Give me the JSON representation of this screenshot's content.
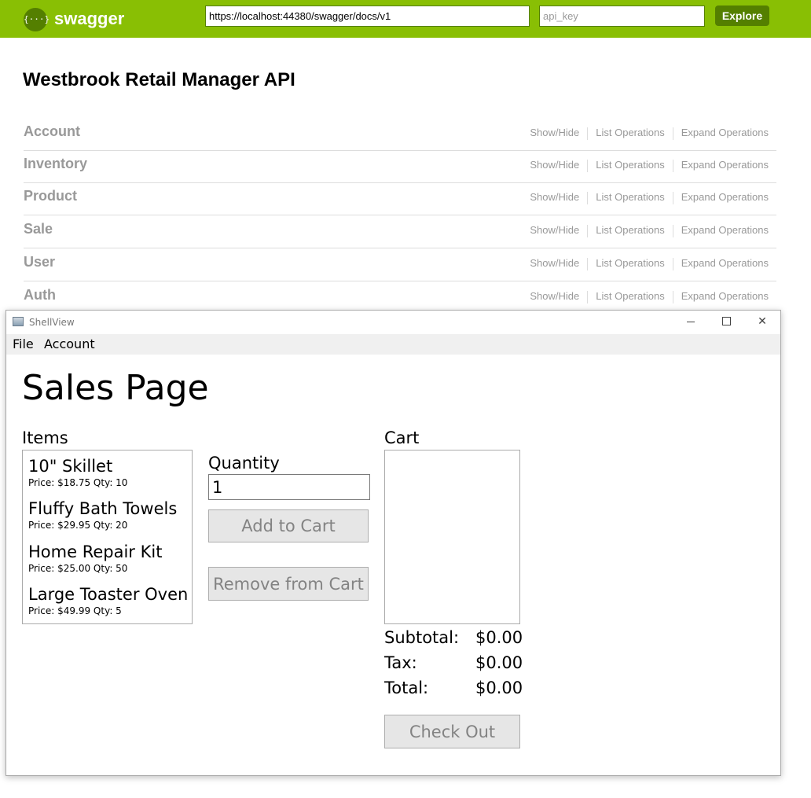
{
  "swagger": {
    "logo_glyph": "{···}",
    "brand": "swagger",
    "url_value": "https://localhost:44380/swagger/docs/v1",
    "api_key_placeholder": "api_key",
    "explore_label": "Explore",
    "api_title": "Westbrook Retail Manager API",
    "accent_color": "#89bf04",
    "resources": [
      {
        "name": "Account",
        "show_hide": "Show/Hide",
        "list_ops": "List Operations",
        "expand_ops": "Expand Operations"
      },
      {
        "name": "Inventory",
        "show_hide": "Show/Hide",
        "list_ops": "List Operations",
        "expand_ops": "Expand Operations"
      },
      {
        "name": "Product",
        "show_hide": "Show/Hide",
        "list_ops": "List Operations",
        "expand_ops": "Expand Operations"
      },
      {
        "name": "Sale",
        "show_hide": "Show/Hide",
        "list_ops": "List Operations",
        "expand_ops": "Expand Operations"
      },
      {
        "name": "User",
        "show_hide": "Show/Hide",
        "list_ops": "List Operations",
        "expand_ops": "Expand Operations"
      },
      {
        "name": "Auth",
        "show_hide": "Show/Hide",
        "list_ops": "List Operations",
        "expand_ops": "Expand Operations"
      }
    ]
  },
  "window": {
    "title": "ShellView",
    "close_glyph": "✕",
    "menu": [
      "File",
      "Account"
    ],
    "page_title": "Sales Page",
    "items_label": "Items",
    "items": [
      {
        "name": "10\" Skillet",
        "meta": "Price: $18.75  Qty: 10"
      },
      {
        "name": "Fluffy Bath Towels",
        "meta": "Price: $29.95  Qty: 20"
      },
      {
        "name": "Home Repair Kit",
        "meta": "Price: $25.00  Qty: 50"
      },
      {
        "name": "Large Toaster Oven",
        "meta": "Price: $49.99  Qty: 5"
      }
    ],
    "quantity_label": "Quantity",
    "quantity_value": "1",
    "add_to_cart_label": "Add to Cart",
    "remove_from_cart_label": "Remove from Cart",
    "cart_label": "Cart",
    "subtotal_label": "Subtotal:",
    "subtotal_value": "$0.00",
    "tax_label": "Tax:",
    "tax_value": "$0.00",
    "total_label": "Total:",
    "total_value": "$0.00",
    "checkout_label": "Check Out"
  }
}
